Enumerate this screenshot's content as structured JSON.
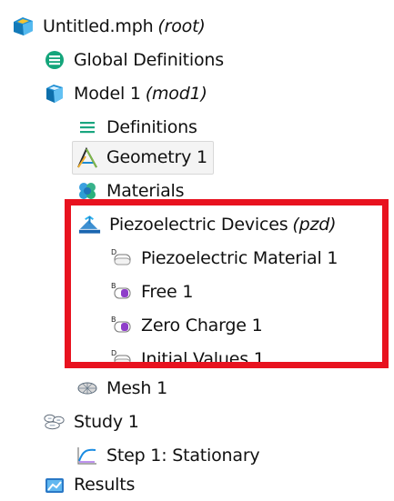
{
  "tree": {
    "root": {
      "label": "Untitled.mph",
      "tag": "(root)",
      "icon": "model-root-icon"
    },
    "global_definitions": {
      "label": "Global Definitions",
      "icon": "global-definitions-icon"
    },
    "model": {
      "label": "Model 1",
      "tag": "(mod1)",
      "icon": "model-component-icon"
    },
    "definitions": {
      "label": "Definitions",
      "icon": "definitions-icon"
    },
    "geometry": {
      "label": "Geometry 1",
      "icon": "geometry-icon",
      "selected": true
    },
    "materials": {
      "label": "Materials",
      "icon": "materials-icon"
    },
    "physics": {
      "label": "Piezoelectric Devices",
      "tag": "(pzd)",
      "icon": "physics-interface-icon"
    },
    "physics_children": [
      {
        "label": "Piezoelectric Material 1",
        "icon": "domain-node-icon"
      },
      {
        "label": "Free 1",
        "icon": "boundary-node-icon"
      },
      {
        "label": "Zero Charge 1",
        "icon": "boundary-node-icon"
      },
      {
        "label": "Initial Values 1",
        "icon": "domain-node-icon"
      }
    ],
    "mesh": {
      "label": "Mesh 1",
      "icon": "mesh-icon"
    },
    "study": {
      "label": "Study 1",
      "icon": "study-icon"
    },
    "step": {
      "label": "Step 1: Stationary",
      "icon": "stationary-step-icon"
    },
    "results": {
      "label": "Results",
      "icon": "results-icon"
    }
  },
  "colors": {
    "highlight_border": "#e8121f",
    "text": "#111111",
    "selection_background": "#f4f4f4",
    "definitions_teal": "#1aa67f",
    "model_blue": "#1f8fd4"
  }
}
